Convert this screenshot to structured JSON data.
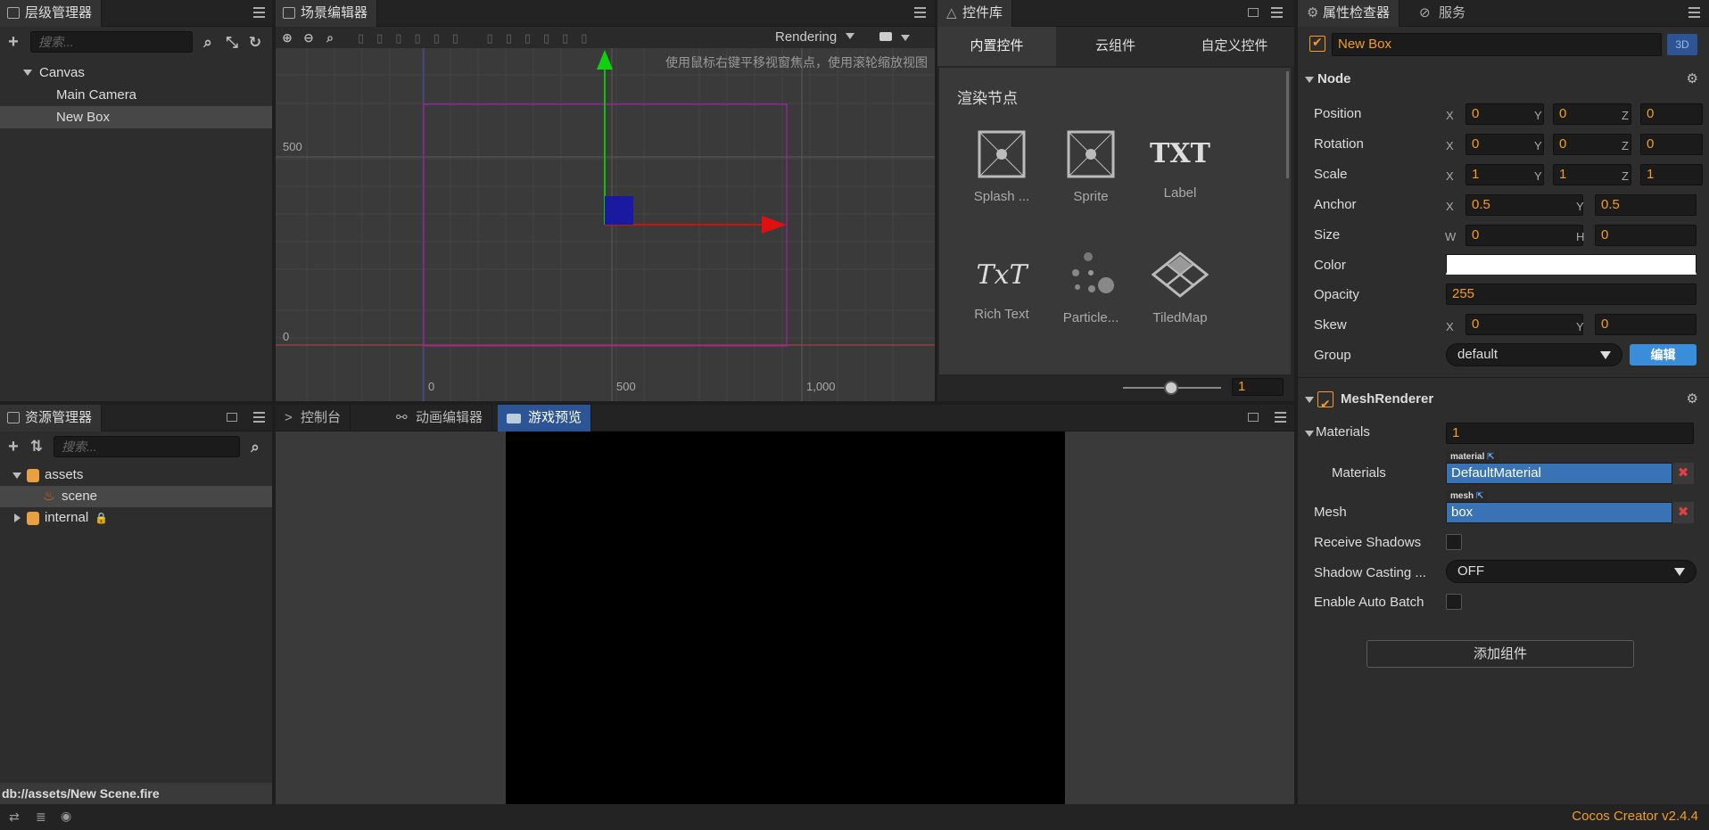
{
  "hierarchy": {
    "title": "层级管理器",
    "search_placeholder": "搜索...",
    "nodes": [
      {
        "label": "Canvas"
      },
      {
        "label": "Main Camera"
      },
      {
        "label": "New Box"
      }
    ]
  },
  "scene": {
    "title": "场景编辑器",
    "hint": "使用鼠标右键平移视窗焦点，使用滚轮缩放视图",
    "render_mode": "Rendering",
    "axis_labels": {
      "y500": "500",
      "y0": "0",
      "x0": "0",
      "x500": "500",
      "x1000": "1,000"
    }
  },
  "components": {
    "title": "控件库",
    "tabs": [
      {
        "label": "内置控件"
      },
      {
        "label": "云组件"
      },
      {
        "label": "自定义控件"
      }
    ],
    "section": "渲染节点",
    "items": [
      {
        "label": "Splash ..."
      },
      {
        "label": "Sprite"
      },
      {
        "label": "Label"
      },
      {
        "label": "Rich Text"
      },
      {
        "label": "Particle..."
      },
      {
        "label": "TiledMap"
      }
    ],
    "icon_txt": "TXT",
    "icon_rich": "TxT",
    "zoom_value": "1"
  },
  "inspector": {
    "title": "属性检查器",
    "service_tab": "服务",
    "node_name": "New Box",
    "mode_3d": "3D",
    "node_section": "Node",
    "position": {
      "label": "Position",
      "x": "0",
      "y": "0",
      "z": "0"
    },
    "rotation": {
      "label": "Rotation",
      "x": "0",
      "y": "0",
      "z": "0"
    },
    "scale": {
      "label": "Scale",
      "x": "1",
      "y": "1",
      "z": "1"
    },
    "anchor": {
      "label": "Anchor",
      "x": "0.5",
      "y": "0.5"
    },
    "size": {
      "label": "Size",
      "w": "0",
      "h": "0"
    },
    "color": {
      "label": "Color",
      "value": "#ffffff"
    },
    "opacity": {
      "label": "Opacity",
      "value": "255"
    },
    "skew": {
      "label": "Skew",
      "x": "0",
      "y": "0"
    },
    "group": {
      "label": "Group",
      "value": "default",
      "edit": "编辑"
    },
    "axes": {
      "x": "X",
      "y": "Y",
      "z": "Z",
      "w": "W",
      "h": "H"
    },
    "mesh_renderer": {
      "title": "MeshRenderer",
      "materials_label": "Materials",
      "materials_count": "1",
      "material_item_label": "Materials",
      "material_tag": "material",
      "material_value": "DefaultMaterial",
      "mesh_label": "Mesh",
      "mesh_tag": "mesh",
      "mesh_value": "box",
      "receive_shadows": "Receive Shadows",
      "shadow_casting": "Shadow Casting ...",
      "shadow_value": "OFF",
      "auto_batch": "Enable Auto Batch"
    },
    "add_component": "添加组件"
  },
  "assets": {
    "title": "资源管理器",
    "search_placeholder": "搜索...",
    "items": [
      {
        "label": "assets"
      },
      {
        "label": "scene"
      },
      {
        "label": "internal"
      }
    ],
    "path": "db://assets/New Scene.fire"
  },
  "bottom": {
    "tabs": [
      {
        "label": "控制台"
      },
      {
        "label": "动画编辑器"
      },
      {
        "label": "游戏预览"
      }
    ]
  },
  "status": {
    "version": "Cocos Creator v2.4.4"
  },
  "colors": {
    "accent": "#f39c2b",
    "selection_blue": "#2d5596",
    "asset_blue": "#3a73b5"
  }
}
